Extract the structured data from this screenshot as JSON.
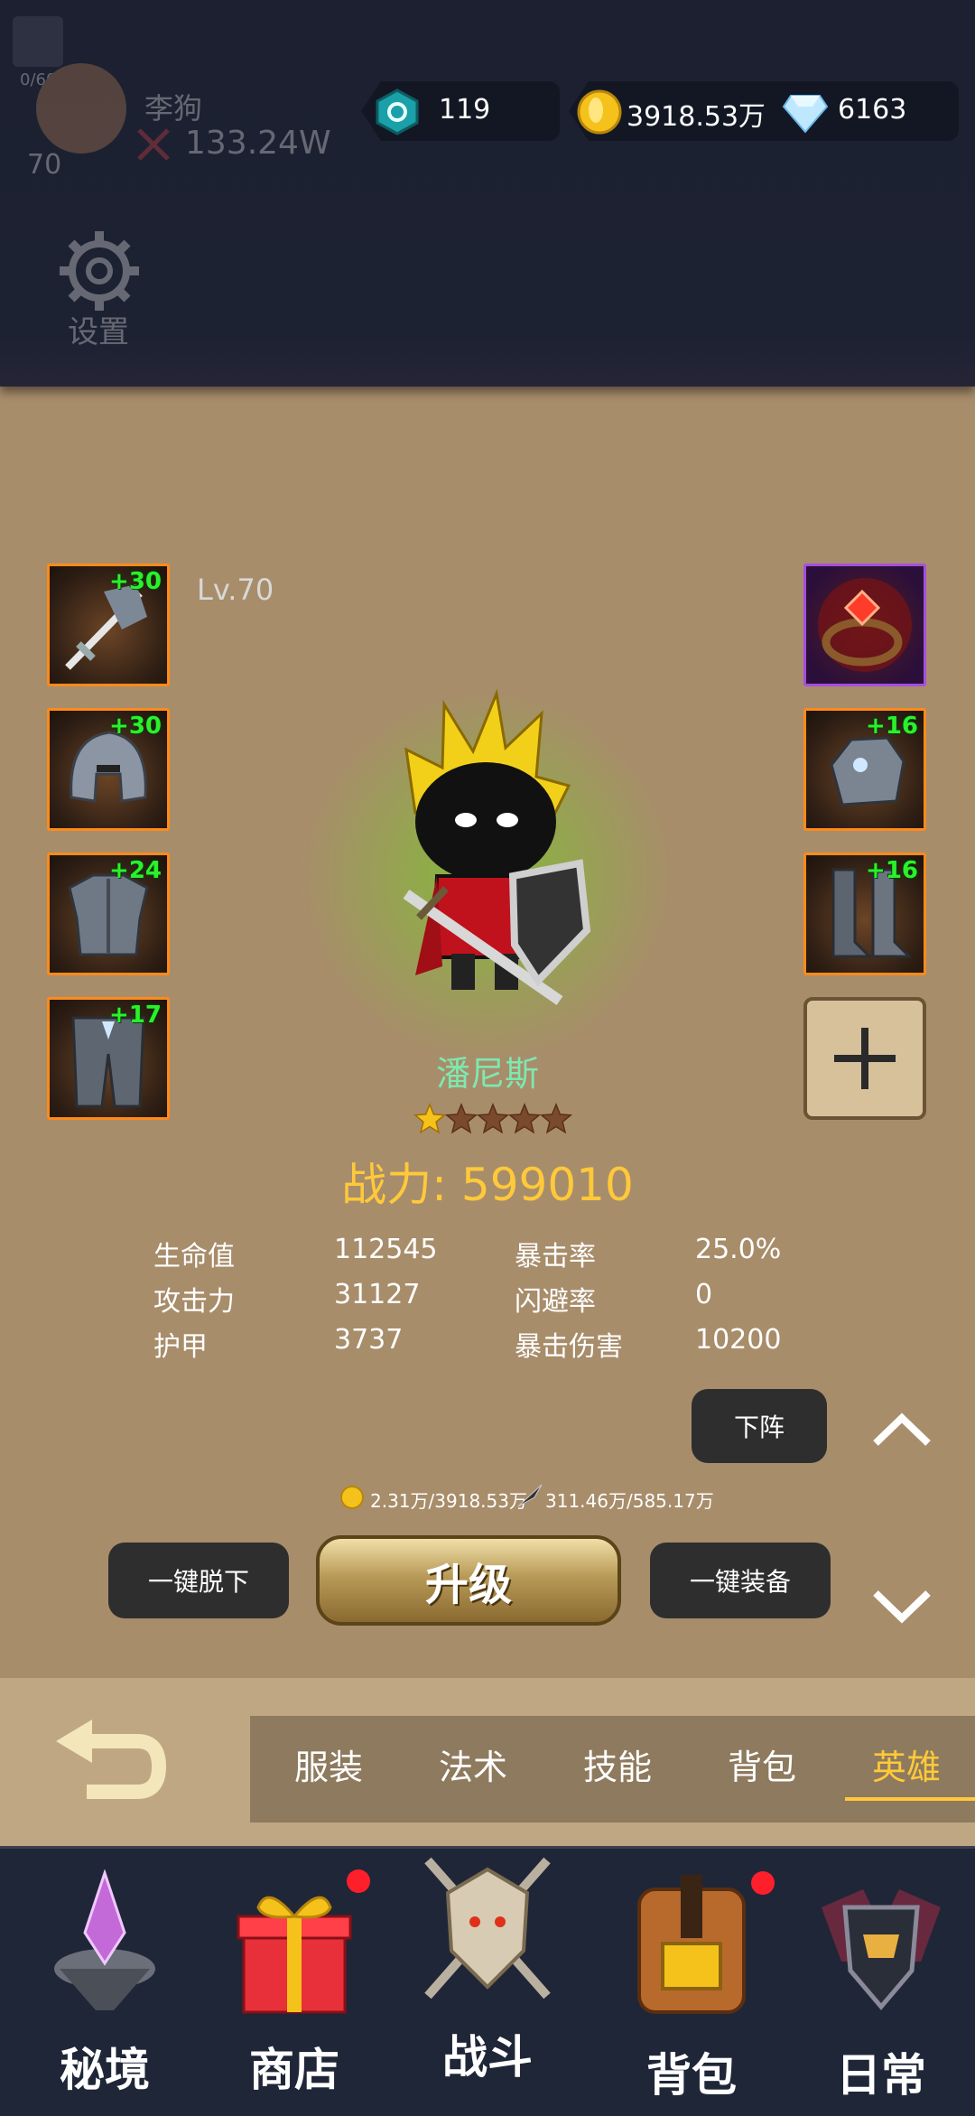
{
  "header": {
    "player": {
      "name": "李狗",
      "power": "133.24W",
      "level": "70",
      "exp": "0/60"
    },
    "settings_label": "设置",
    "resources": [
      {
        "icon": "rune-gem-icon",
        "value": "119"
      },
      {
        "icon": "gold-coin-icon",
        "value": "3918.53万"
      },
      {
        "icon": "diamond-icon",
        "value": "6163"
      }
    ]
  },
  "hero": {
    "level": "Lv.70",
    "name": "潘尼斯",
    "stars_filled": 1,
    "stars_total": 5,
    "power_label": "战力: 599010",
    "stats": [
      {
        "label": "生命值",
        "value": "112545"
      },
      {
        "label": "攻击力",
        "value": "31127"
      },
      {
        "label": "护甲",
        "value": "3737"
      },
      {
        "label": "暴击率",
        "value": "25.0%"
      },
      {
        "label": "闪避率",
        "value": "0"
      },
      {
        "label": "暴击伤害",
        "value": "10200"
      }
    ],
    "equipment_left": [
      {
        "item": "sword-icon",
        "plus": "+30"
      },
      {
        "item": "helmet-icon",
        "plus": "+30"
      },
      {
        "item": "chest-armor-icon",
        "plus": "+24"
      },
      {
        "item": "leg-armor-icon",
        "plus": "+17"
      }
    ],
    "equipment_right": [
      {
        "item": "ring-icon",
        "plus": ""
      },
      {
        "item": "gauntlet-icon",
        "plus": "+16"
      },
      {
        "item": "boots-icon",
        "plus": "+16"
      }
    ]
  },
  "actions": {
    "dismiss": "下阵",
    "cost_text": "2.31万/3918.53万",
    "exp_text": "311.46万/585.17万",
    "unequip_all": "一键脱下",
    "upgrade": "升级",
    "equip_all": "一键装备"
  },
  "tabs": [
    {
      "label": "服装",
      "active": false
    },
    {
      "label": "法术",
      "active": false
    },
    {
      "label": "技能",
      "active": false
    },
    {
      "label": "背包",
      "active": false
    },
    {
      "label": "英雄",
      "active": true
    }
  ],
  "bottom_nav": [
    {
      "label": "秘境",
      "badge": false
    },
    {
      "label": "商店",
      "badge": true
    },
    {
      "label": "战斗",
      "badge": false
    },
    {
      "label": "背包",
      "badge": true
    },
    {
      "label": "日常",
      "badge": false
    }
  ],
  "colors": {
    "background": "#a88d6b",
    "gold_text": "#ffc93a",
    "hero_name": "#7ee8b0",
    "slot_border": "#ff8a1a",
    "plus_text": "#2bf02b"
  }
}
